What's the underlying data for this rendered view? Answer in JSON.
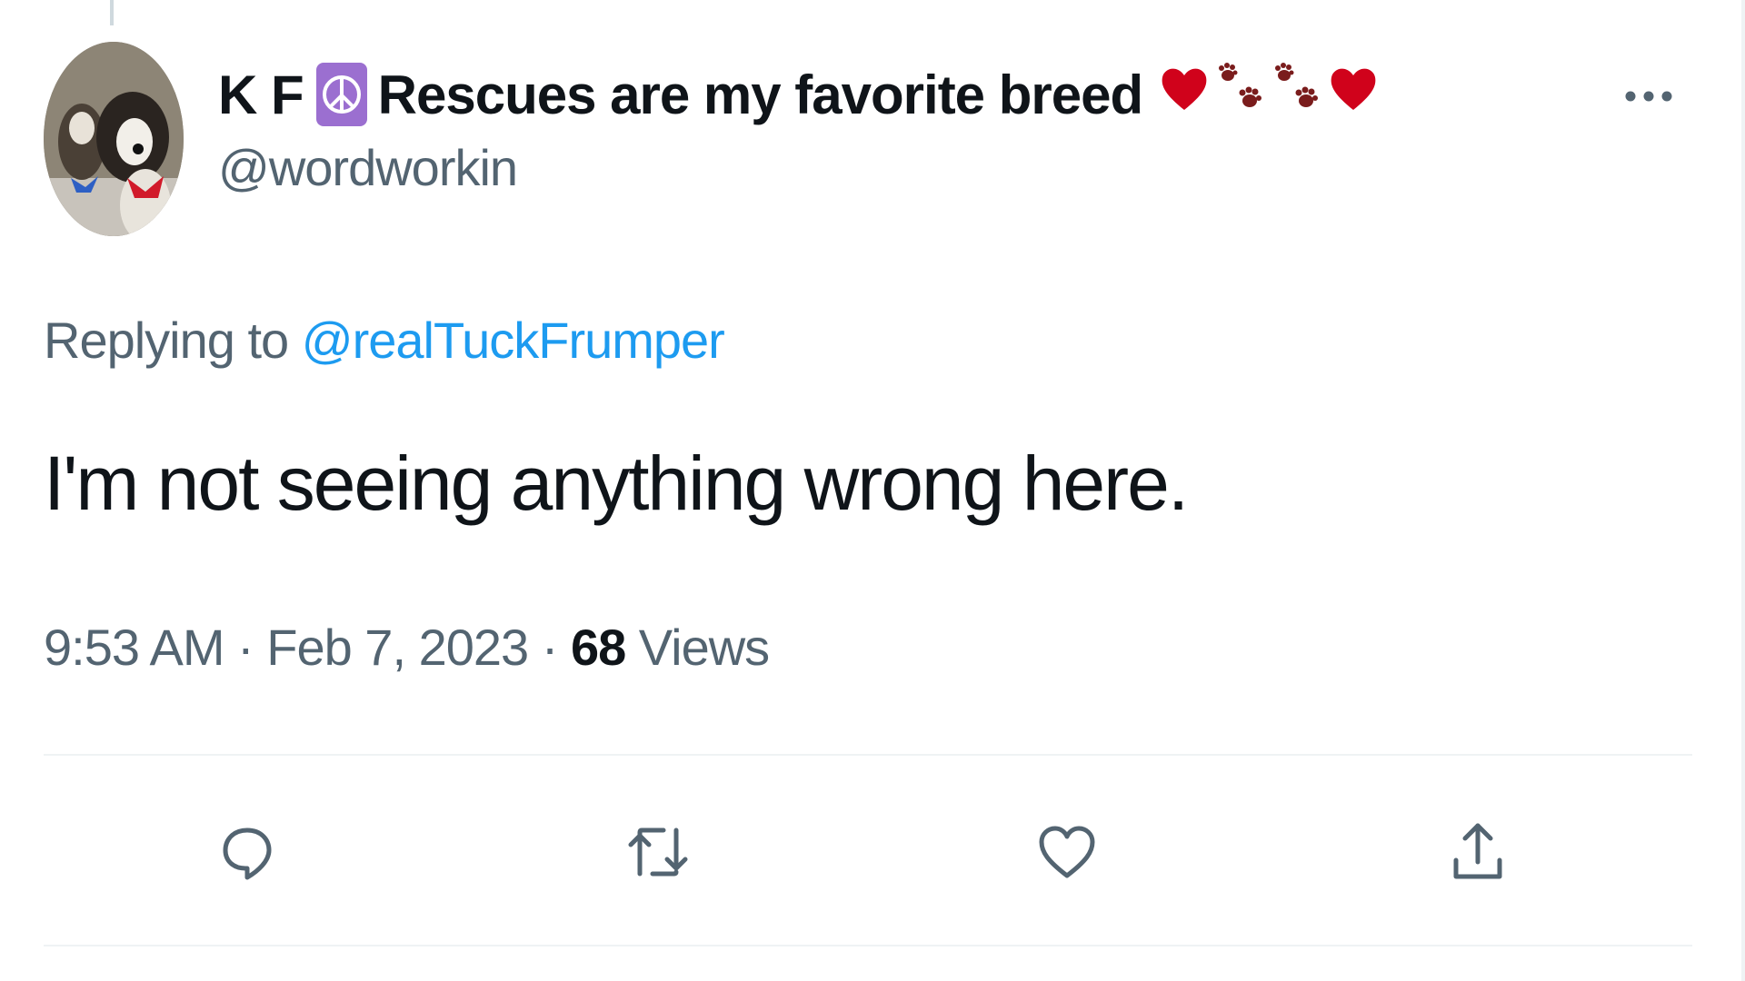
{
  "tweet": {
    "author": {
      "name_start": "K F",
      "name_end": "Rescues are my favorite breed",
      "badge_icon": "peace-symbol-icon",
      "emoji_icons": [
        "red-heart-icon",
        "paw-prints-icon",
        "paw-prints-icon",
        "red-heart-icon"
      ],
      "handle": "@wordworkin"
    },
    "replying_prefix": "Replying to",
    "replying_to": "@realTuckFrumper",
    "text": "I'm not seeing anything wrong here.",
    "time": "9:53 AM",
    "separator": "·",
    "date": "Feb 7, 2023",
    "views_count": "68",
    "views_label": "Views"
  },
  "icons": {
    "more": "more-horizontal-icon",
    "reply": "reply-icon",
    "retweet": "retweet-icon",
    "like": "like-icon",
    "share": "share-icon"
  },
  "colors": {
    "link": "#1d9bf0",
    "secondary_text": "#536471",
    "primary_text": "#0f1419",
    "divider": "#eff3f4",
    "heart": "#d0021b",
    "paw": "#7a1c1c",
    "badge": "#9b6fd0"
  }
}
